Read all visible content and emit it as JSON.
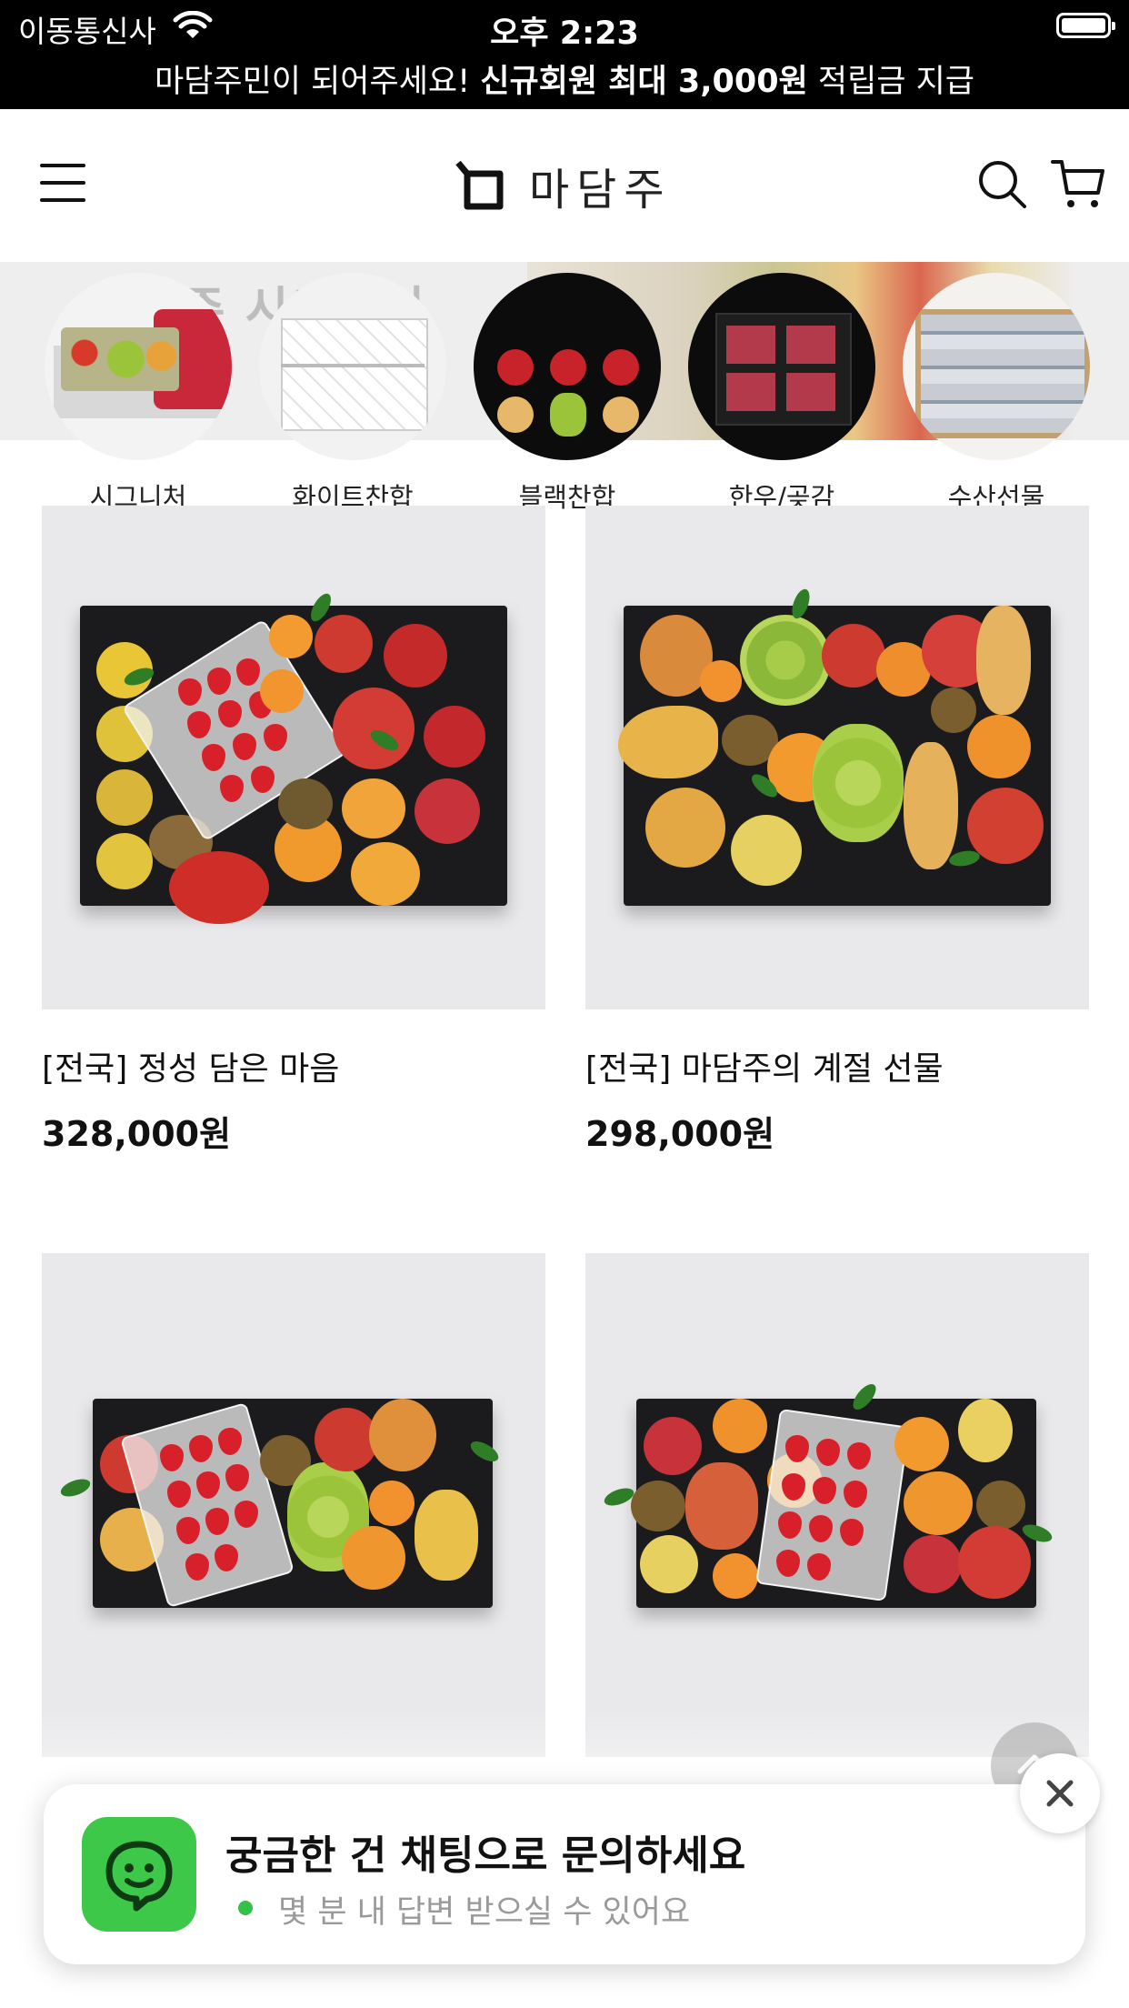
{
  "status_bar": {
    "carrier": "이동통신사",
    "time": "오후 2:23"
  },
  "promo": {
    "prefix": "마담주민이 되어주세요! ",
    "highlight": "신규회원 최대 3,000원",
    "suffix": " 적립금 지급"
  },
  "header": {
    "logo_text": "마담주"
  },
  "banner": {
    "faint_text": "마담주 시그니처"
  },
  "categories": [
    {
      "label": "시그니처"
    },
    {
      "label": "화이트찬합"
    },
    {
      "label": "블랙찬합"
    },
    {
      "label": "한우/곶감"
    },
    {
      "label": "수산선물"
    }
  ],
  "products": [
    {
      "name": "[전국] 정성 담은 마음",
      "price": "328,000원"
    },
    {
      "name": "[전국] 마담주의 계절 선물",
      "price": "298,000원"
    },
    {
      "name": "",
      "price": ""
    },
    {
      "name": "",
      "price": ""
    }
  ],
  "chat": {
    "title": "궁금한 건 채팅으로 문의하세요",
    "subtitle": "몇 분 내 답변 받으실 수 있어요"
  },
  "colors": {
    "accent_green": "#3dc84a",
    "bar_black": "#000000"
  }
}
